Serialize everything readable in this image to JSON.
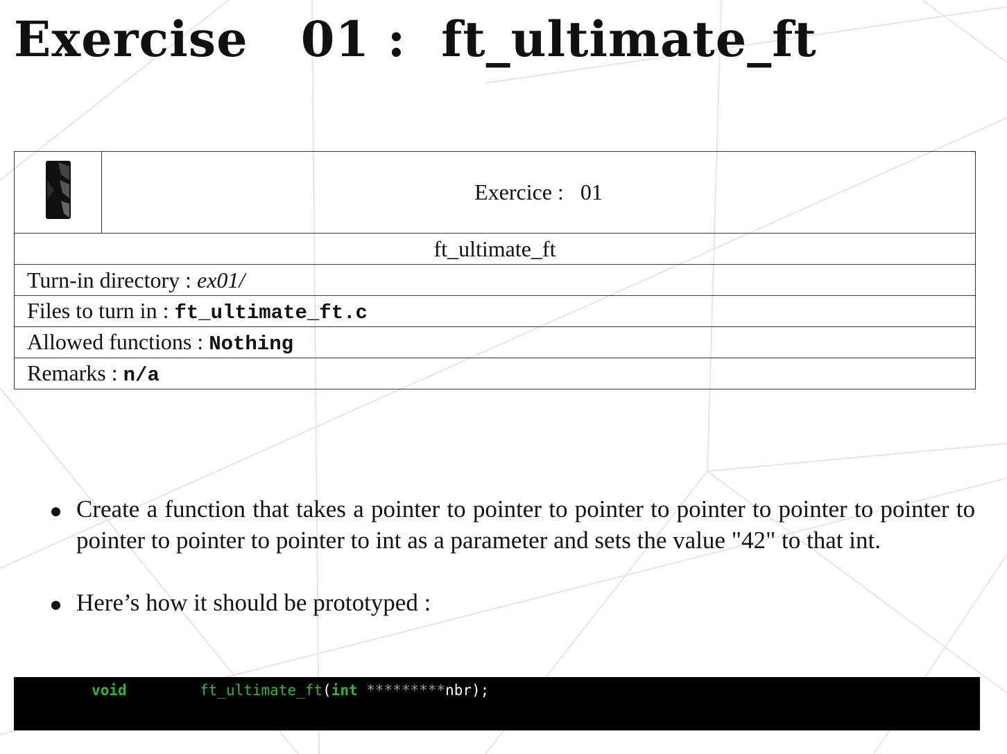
{
  "title": "Exercise   01 :  ft_ultimate_ft",
  "info_table": {
    "exercise_label": "Exercice :",
    "exercise_number": "01",
    "function_name": "ft_ultimate_ft",
    "turn_in_label": "Turn-in directory :",
    "turn_in_value": "ex01/",
    "files_label": "Files to turn in :",
    "files_value": "ft_ultimate_ft.c",
    "allowed_label": "Allowed functions :",
    "allowed_value": "Nothing",
    "remarks_label": "Remarks :",
    "remarks_value": "n/a"
  },
  "bullets": [
    "Create a function that takes a pointer to pointer to pointer to pointer to pointer to pointer to pointer to pointer to pointer to int as a parameter and sets the value \"42\" to that int.",
    "Here’s how it should be prototyped :"
  ],
  "code": {
    "return_type": "void",
    "function_name": "ft_ultimate_ft",
    "open_paren": "(",
    "param_type": "int",
    "stars": " *********",
    "param_name": "nbr);"
  },
  "colors": {
    "code_background": "#000000",
    "code_keyword": "#2eb82e",
    "code_stars": "#9a9a9a"
  }
}
